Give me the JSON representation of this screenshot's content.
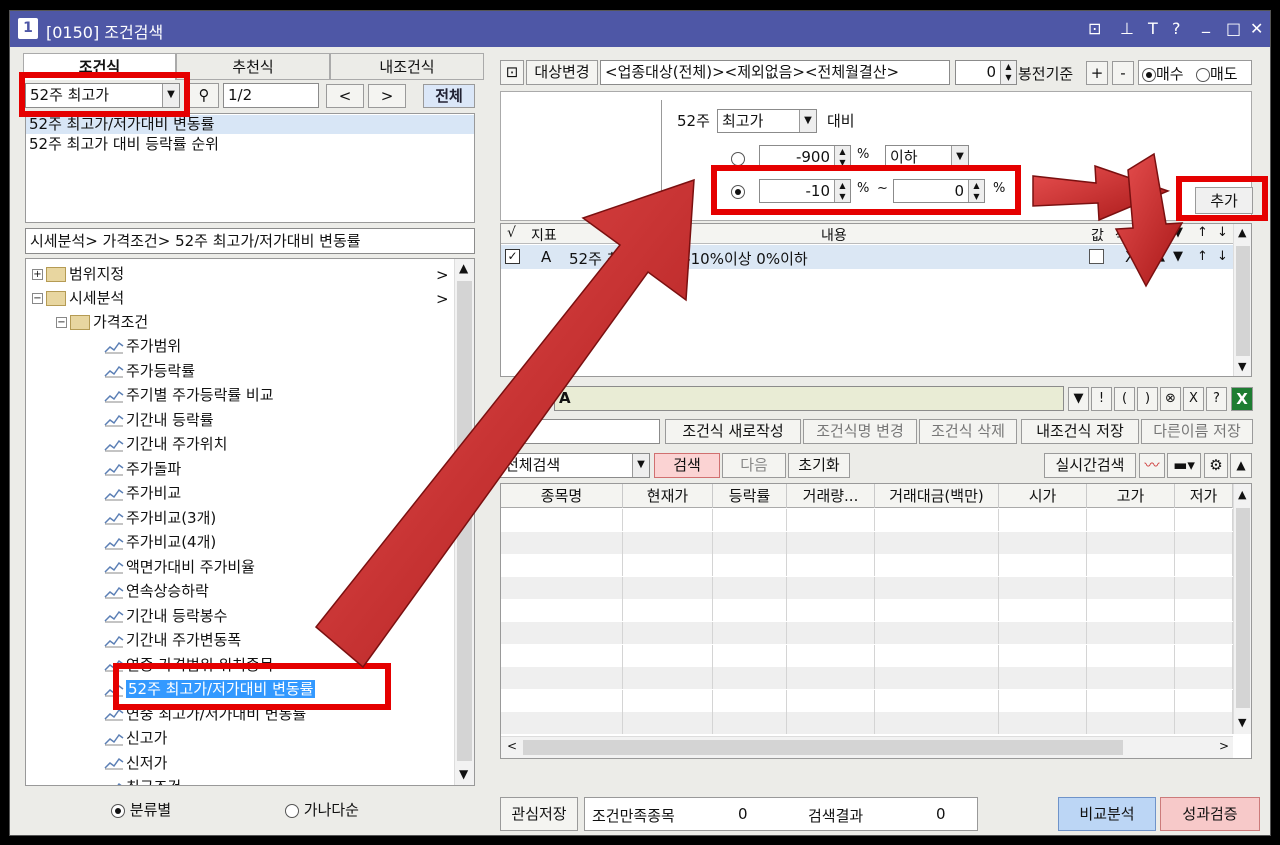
{
  "window": {
    "screen_no": "1",
    "title": "[0150] 조건검색"
  },
  "title_icons": [
    "restore-icon",
    "pin-icon",
    "text-icon",
    "help-icon",
    "minimize-icon",
    "maximize-icon",
    "close-icon"
  ],
  "title_glyphs": {
    "restore": "⊡",
    "pin": "⊥",
    "text": "T",
    "help": "?",
    "minimize": "_",
    "maximize": "□",
    "close": "✕"
  },
  "left": {
    "tabs": [
      "조건식",
      "추천식",
      "내조건식"
    ],
    "search": {
      "value": "52주 최고가",
      "page": "1/2",
      "prev": "<",
      "next": ">",
      "all": "전체"
    },
    "results": [
      "52주 최고가/저가대비 변동률",
      "52주 최고가 대비 등락률 순위"
    ],
    "path": "시세분석> 가격조건> 52주 최고가/저가대비 변동률",
    "tree": {
      "root1": "범위지정",
      "root2": "시세분석",
      "folder": "가격조건",
      "items": [
        "주가범위",
        "주가등락률",
        "주기별 주가등락률 비교",
        "기간내 등락률",
        "기간내 주가위치",
        "주가돌파",
        "주가비교",
        "주가비교(3개)",
        "주가비교(4개)",
        "액면가대비 주가비율",
        "연속상승하락",
        "기간내 등락봉수",
        "기간내 주가변동폭",
        "연중 가격범위 위치종목",
        "52주 최고가/저가대비 변동률",
        "연중 최고가/저가대비 변동률",
        "신고가",
        "신저가",
        "최근조건"
      ]
    },
    "radio_category": "분류별",
    "radio_alpha": "가나다순"
  },
  "right": {
    "target_btn": "대상변경",
    "target_text": "<업종대상(전체)><제외없음><전체월결산>",
    "bong_value": "0",
    "bong_label": "봉전기준",
    "plus": "+",
    "minus": "-",
    "buy": "매수",
    "sell": "매도",
    "cond": {
      "period": "52주",
      "type": "최고가",
      "compare": "대비",
      "v1": "-900",
      "pct1": "%",
      "op1": "이하",
      "v2a": "-10",
      "pct2": "%",
      "tilde": "~",
      "v2b": "0",
      "pct3": "%",
      "add_btn": "추가"
    },
    "table_headers": [
      "√",
      "지표",
      "내용",
      "값",
      "삭제",
      "▲",
      "▼",
      "↑",
      "↓"
    ],
    "table_row": {
      "id": "A",
      "content": "52주 최고가 대비 -10%이상 0%이하",
      "del": "X",
      "up": "▲",
      "down": "▼",
      "top": "↑",
      "bottom": "↓"
    },
    "formula_label": "조건식",
    "formula_value": "A",
    "formula_btns": [
      "▼",
      "!",
      "(",
      ")",
      "⊗",
      "X",
      "?"
    ],
    "excel_glyph": "X",
    "actions": [
      "조건식 새로작성",
      "조건식명 변경",
      "조건식 삭제",
      "내조건식 저장",
      "다른이름 저장"
    ],
    "search_scope": "전체검색",
    "search_btn": "검색",
    "next_btn": "다음",
    "reset_btn": "초기화",
    "realtime_btn": "실시간검색",
    "grid_headers": [
      "종목명",
      "현재가",
      "등락률",
      "거래량...",
      "거래대금(백만)",
      "시가",
      "고가",
      "저가"
    ],
    "bottom": {
      "watch_save": "관심저장",
      "match_label": "조건만족종목",
      "match_value": "0",
      "result_label": "검색결과",
      "result_value": "0",
      "compare_btn": "비교분석",
      "verify_btn": "성과검증"
    }
  },
  "colors": {
    "title_bar": "#4e57a6",
    "highlight_red": "#e50000",
    "arrow_red": "#d42a2a",
    "selected_blue": "#3399ff",
    "compare_btn": "#bcd6f5",
    "verify_btn": "#f7c9c9"
  }
}
